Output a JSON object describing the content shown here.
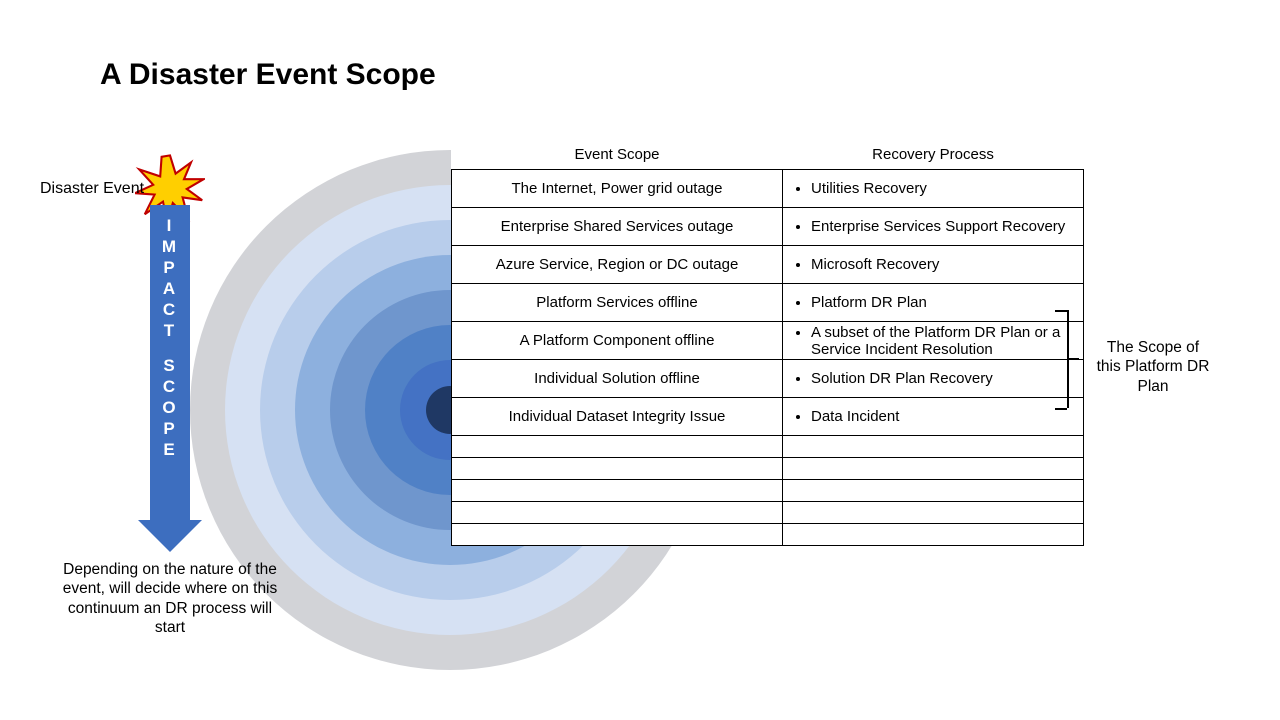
{
  "title": "A Disaster Event Scope",
  "disaster_label": "Disaster Event",
  "arrow_text": "IMPACT SCOPE",
  "arrow_caption": "Depending on the nature of the event, will decide where on this continuum an DR process will start",
  "headers": {
    "scope": "Event Scope",
    "recovery": "Recovery Process"
  },
  "rows": [
    {
      "scope": "The Internet, Power grid outage",
      "recovery": [
        "Utilities Recovery"
      ]
    },
    {
      "scope": "Enterprise Shared Services outage",
      "recovery": [
        "Enterprise Services Support Recovery"
      ]
    },
    {
      "scope": "Azure Service, Region or DC outage",
      "recovery": [
        "Microsoft Recovery"
      ]
    },
    {
      "scope": "Platform Services offline",
      "recovery": [
        "Platform DR Plan"
      ]
    },
    {
      "scope": "A Platform Component offline",
      "recovery": [
        "A subset of the Platform DR Plan or a Service Incident Resolution"
      ]
    },
    {
      "scope": "Individual Solution offline",
      "recovery": [
        "Solution DR Plan Recovery"
      ]
    },
    {
      "scope": "Individual Dataset Integrity Issue",
      "recovery": [
        "Data Incident"
      ]
    },
    {
      "scope": "",
      "recovery": []
    },
    {
      "scope": "",
      "recovery": []
    },
    {
      "scope": "",
      "recovery": []
    },
    {
      "scope": "",
      "recovery": []
    },
    {
      "scope": "",
      "recovery": []
    }
  ],
  "bracket_label": "The Scope of this Platform DR Plan",
  "ring_colors": [
    "#d2d3d7",
    "#d6e1f3",
    "#b8cdeb",
    "#8db0de",
    "#6f96cd",
    "#5081c6",
    "#4472c4",
    "#1f3864"
  ]
}
